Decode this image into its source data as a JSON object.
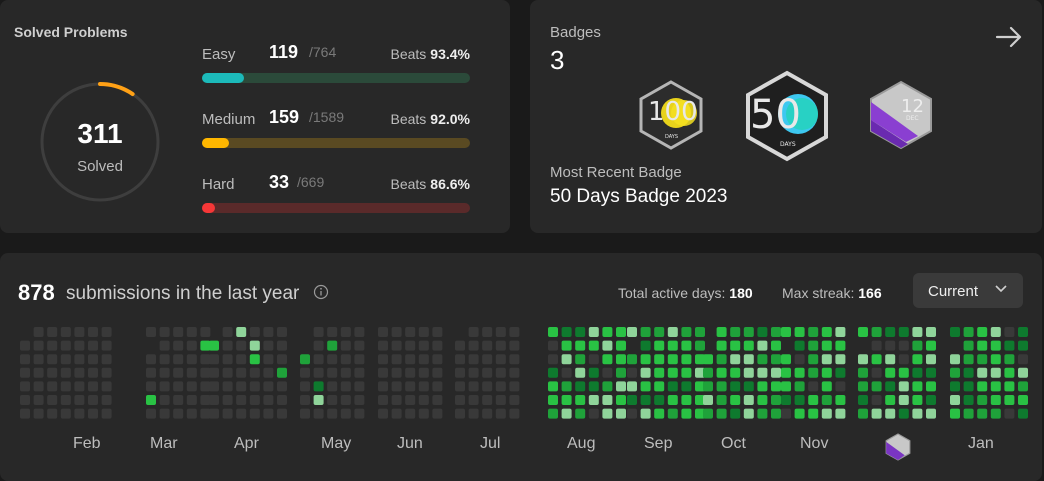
{
  "solved": {
    "title": "Solved Problems",
    "count": "311",
    "count_label": "Solved",
    "progress_fraction": 0.095,
    "difficulties": [
      {
        "label": "Easy",
        "count": "119",
        "total": "/764",
        "beats_label": "Beats",
        "beats": "93.4%",
        "fill": 0.156,
        "color": "#1cbaba",
        "track": "#2b4a3a"
      },
      {
        "label": "Medium",
        "count": "159",
        "total": "/1589",
        "beats_label": "Beats",
        "beats": "92.0%",
        "fill": 0.1,
        "color": "#ffb700",
        "track": "#5a4a22"
      },
      {
        "label": "Hard",
        "count": "33",
        "total": "/669",
        "beats_label": "Beats",
        "beats": "86.6%",
        "fill": 0.049,
        "color": "#f63737",
        "track": "#5a2a2a"
      }
    ]
  },
  "badges": {
    "label": "Badges",
    "count": "3",
    "recent_label": "Most Recent Badge",
    "recent_name": "50 Days Badge 2023",
    "items": [
      {
        "name": "100-days-badge",
        "text": "100",
        "sub": "DAYS"
      },
      {
        "name": "50-days-badge",
        "text": "50",
        "sub": "DAYS"
      },
      {
        "name": "dec-badge",
        "text": "12",
        "sub": "DEC"
      }
    ]
  },
  "calendar": {
    "count": "878",
    "text": "submissions in the last year",
    "active_label": "Total active days:",
    "active_value": "180",
    "streak_label": "Max streak:",
    "streak_value": "166",
    "select_value": "Current",
    "months": [
      "Feb",
      "Mar",
      "Apr",
      "May",
      "Jun",
      "Jul",
      "Aug",
      "Sep",
      "Oct",
      "Nov",
      "Jan"
    ],
    "colors": {
      "empty": "#393939",
      "l1": "#0e7a2e",
      "l2": "#1fa23a",
      "l3": "#29c244",
      "l4": "#8fd49a"
    }
  }
}
